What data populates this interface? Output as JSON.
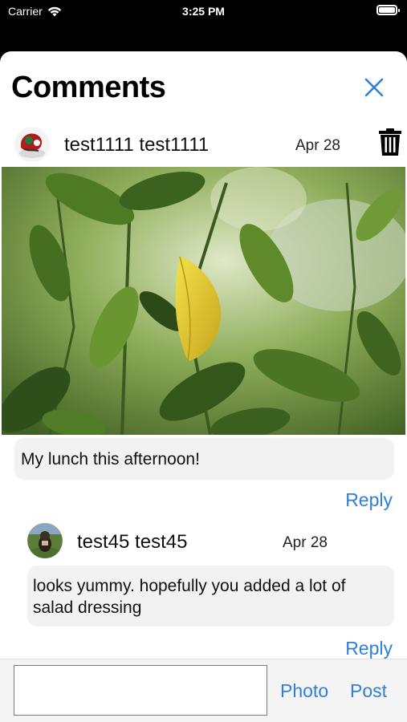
{
  "status_bar": {
    "carrier": "Carrier",
    "time": "3:25 PM"
  },
  "header": {
    "title": "Comments",
    "close_icon": "close-icon"
  },
  "post": {
    "author": "test1111 test1111",
    "date": "Apr 28",
    "caption": "My lunch this afternoon!",
    "reply_label": "Reply"
  },
  "replies": [
    {
      "author": "test45 test45",
      "date": "Apr 28",
      "text": "looks yummy. hopefully you added a lot of salad dressing",
      "reply_label": "Reply"
    }
  ],
  "composer": {
    "input_value": "",
    "photo_label": "Photo",
    "post_label": "Post"
  },
  "colors": {
    "accent": "#2f80d8",
    "bubble": "#f2f2f3",
    "status_bar_bg": "#000000"
  }
}
